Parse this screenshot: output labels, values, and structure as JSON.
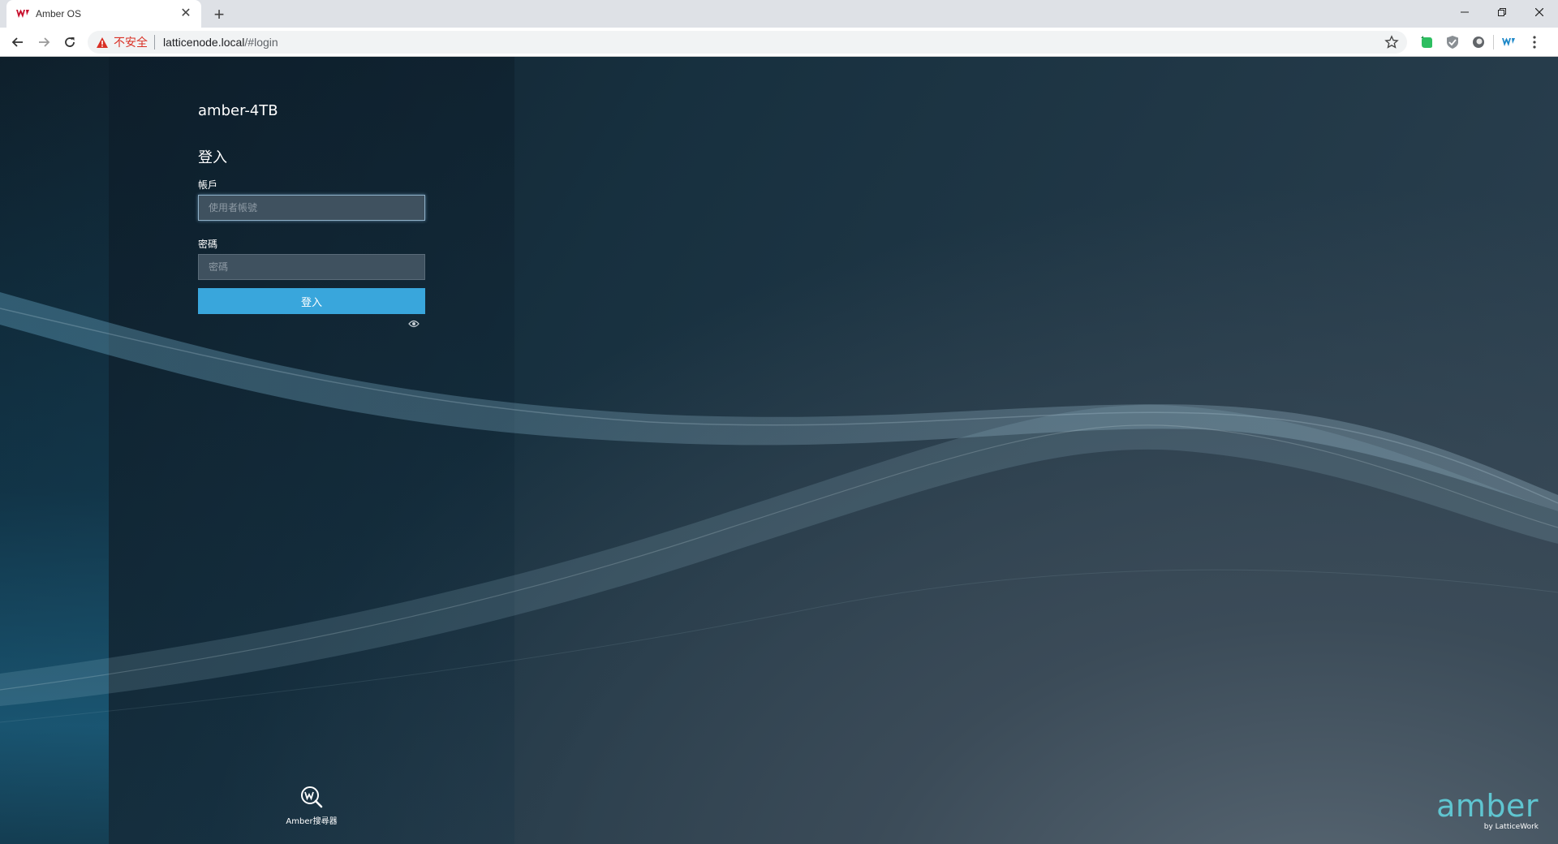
{
  "browser": {
    "tab_title": "Amber OS",
    "new_tab_symbol": "+",
    "insecure_label": "不安全",
    "url_host": "latticenode.local",
    "url_path": "/#login",
    "extensions": [
      "evernote-icon",
      "shield-extension-icon",
      "circle-extension-icon",
      "lattice-extension-icon"
    ]
  },
  "login": {
    "device_name": "amber-4TB",
    "title": "登入",
    "account_label": "帳戶",
    "account_placeholder": "使用者帳號",
    "account_value": "",
    "password_label": "密碼",
    "password_placeholder": "密碼",
    "password_value": "",
    "submit_label": "登入"
  },
  "footer": {
    "finder_label": "Amber搜尋器",
    "brand_name": "amber",
    "brand_sub": "by LatticeWork"
  },
  "colors": {
    "accent": "#39a6dc",
    "brand": "#5fc5d0",
    "insecure": "#d93025"
  }
}
